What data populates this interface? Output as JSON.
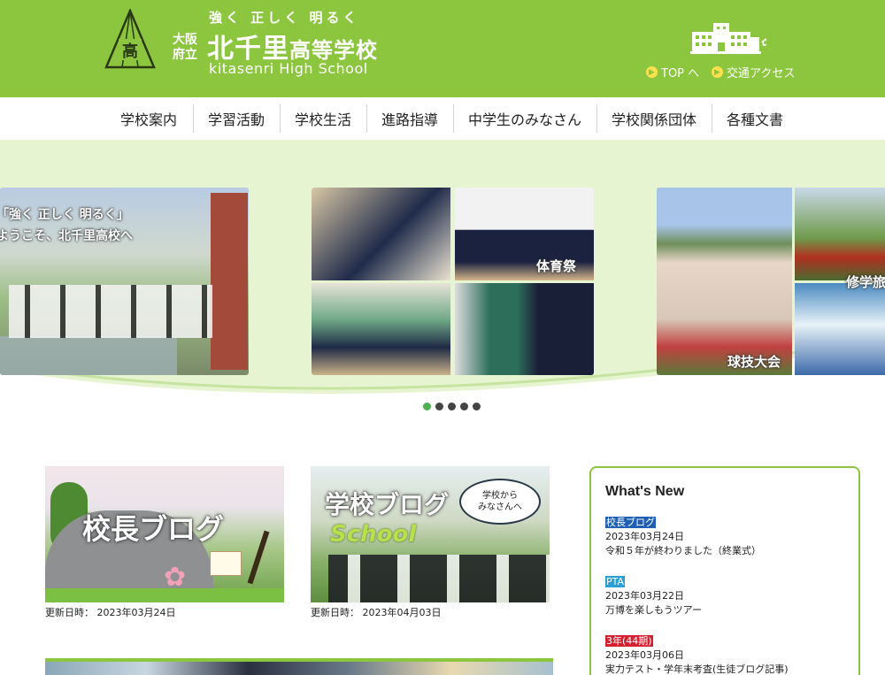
{
  "header": {
    "slogan": "強く 正しく 明るく",
    "pref": "大阪府立",
    "pref_line1": "大阪",
    "pref_line2": "府立",
    "name_main": "北千里",
    "name_sub": "高等学校",
    "name_en": "kitasenri High School",
    "emblem_char": "高",
    "links": [
      {
        "label": "TOP へ"
      },
      {
        "label": "交通アクセス"
      }
    ]
  },
  "nav": {
    "items": [
      {
        "label": "学校案内"
      },
      {
        "label": "学習活動"
      },
      {
        "label": "学校生活"
      },
      {
        "label": "進路指導"
      },
      {
        "label": "中学生のみなさん"
      },
      {
        "label": "学校関係団体"
      },
      {
        "label": "各種文書"
      }
    ]
  },
  "hero": {
    "slides": [
      {
        "caption_line1": "「強く 正しく 明るく」",
        "caption_line2": "ようこそ、北千里高校へ"
      },
      {
        "labels": [
          "体育祭"
        ]
      },
      {
        "labels": [
          "球技大会",
          "修学旅"
        ]
      }
    ],
    "pager_count": 5,
    "pager_active": 0
  },
  "cards": [
    {
      "title": "校長ブログ",
      "date_label": "更新日時：",
      "date": "2023年03月24日"
    },
    {
      "title": "学校ブログ",
      "sub": "School",
      "bubble": "学校から\nみなさんへ",
      "date_label": "更新日時：",
      "date": "2023年04月03日"
    }
  ],
  "news": {
    "title": "What's New",
    "items": [
      {
        "tag": "校長ブログ",
        "tag_color": "#1e5fb4",
        "date": "2023年03月24日",
        "text": "令和５年が終わりました（終業式）"
      },
      {
        "tag": "PTA",
        "tag_color": "#2aa0d8",
        "date": "2023年03月22日",
        "text": "万博を楽しもうツアー"
      },
      {
        "tag": "3年(44期)",
        "tag_color": "#d62030",
        "date": "2023年03月06日",
        "text": "実力テスト・学年末考査(生徒ブログ記事)"
      }
    ]
  },
  "colors": {
    "brand_green": "#8cc63f",
    "hero_bg": "#e6f4d2",
    "pager_active": "#4caf50"
  }
}
